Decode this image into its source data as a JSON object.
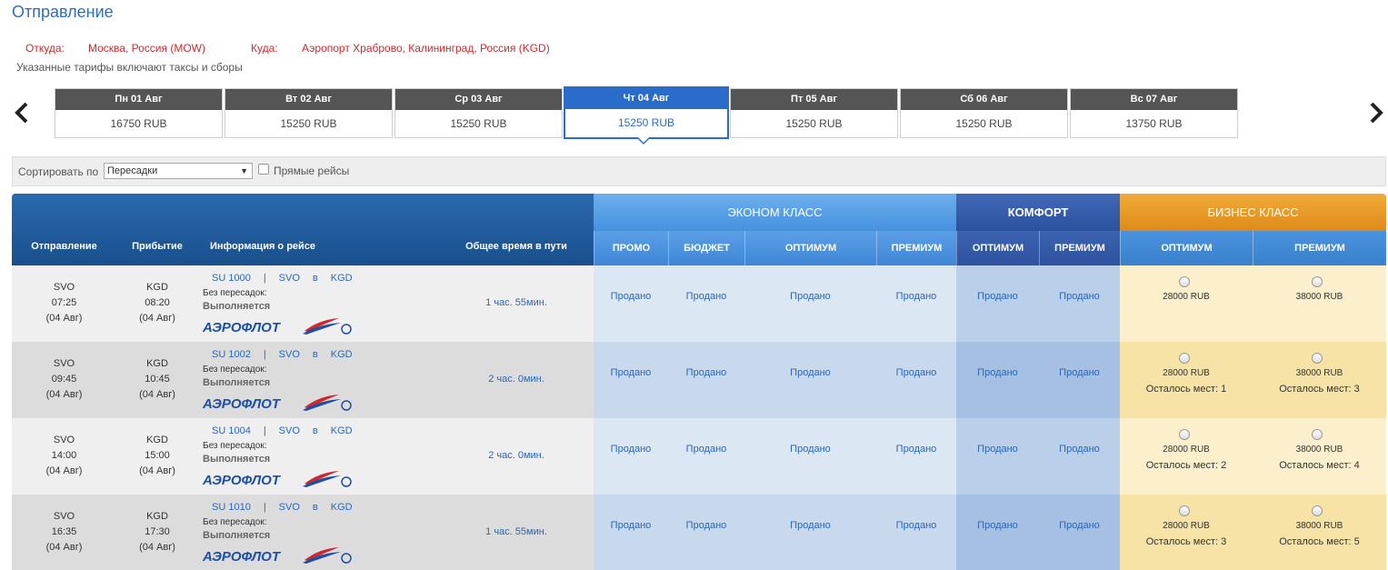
{
  "page": {
    "title": "Отправление"
  },
  "route": {
    "from_label": "Откуда:",
    "from_value": "Москва, Россия (MOW)",
    "to_label": "Куда:",
    "to_value": "Аэропорт Храброво, Калининград, Россия (KGD)",
    "note": "Указанные тарифы включают таксы и сборы"
  },
  "nav": {
    "prev_icon": "chevron-left-icon",
    "next_icon": "chevron-right-icon"
  },
  "days": [
    {
      "label": "Пн 01 Авг",
      "price": "16750 RUB"
    },
    {
      "label": "Вт 02 Авг",
      "price": "15250 RUB"
    },
    {
      "label": "Ср 03 Авг",
      "price": "15250 RUB"
    },
    {
      "label": "Чт 04 Авг",
      "price": "15250 RUB",
      "selected": true
    },
    {
      "label": "Пт 05 Авг",
      "price": "15250 RUB"
    },
    {
      "label": "Сб 06 Авг",
      "price": "15250 RUB"
    },
    {
      "label": "Вс 07 Авг",
      "price": "13750 RUB"
    }
  ],
  "sort": {
    "label": "Сортировать по",
    "selected": "Пересадки",
    "direct_label": "Прямые рейсы",
    "direct_checked": false
  },
  "table": {
    "headers": {
      "departure": "Отправление",
      "arrival": "Прибытие",
      "flight_info": "Информация о рейсе",
      "total_time": "Общее время в пути"
    },
    "classes": {
      "economy": "ЭКОНОМ КЛАСС",
      "comfort": "КОМФОРТ",
      "business": "БИЗНЕС КЛАСС"
    },
    "fare_columns": {
      "econ_promo": "ПРОМО",
      "econ_budget": "БЮДЖЕТ",
      "econ_optimum": "ОПТИМУМ",
      "econ_premium": "ПРЕМИУМ",
      "comf_optimum": "ОПТИМУМ",
      "comf_premium": "ПРЕМИУМ",
      "bus_optimum": "ОПТИМУМ",
      "bus_premium": "ПРЕМИУМ"
    },
    "sold_text": "Продано",
    "nonstop_text": "Без пересадок:",
    "status_text": "Выполняется",
    "in_text": "в",
    "airline_logo_text": "АЭРОФЛОТ",
    "rows": [
      {
        "dep_code": "SVO",
        "dep_time": "07:25",
        "dep_date": "(04 Авг)",
        "arr_code": "KGD",
        "arr_time": "08:20",
        "arr_date": "(04 Авг)",
        "flight": "SU 1000",
        "from": "SVO",
        "to": "KGD",
        "duration": "1 час. 55мин.",
        "bus_opt_price": "28000 RUB",
        "bus_opt_seats": "",
        "bus_prem_price": "38000 RUB",
        "bus_prem_seats": ""
      },
      {
        "dep_code": "SVO",
        "dep_time": "09:45",
        "dep_date": "(04 Авг)",
        "arr_code": "KGD",
        "arr_time": "10:45",
        "arr_date": "(04 Авг)",
        "flight": "SU 1002",
        "from": "SVO",
        "to": "KGD",
        "duration": "2 час. 0мин.",
        "bus_opt_price": "28000 RUB",
        "bus_opt_seats": "Осталось мест: 1",
        "bus_prem_price": "38000 RUB",
        "bus_prem_seats": "Осталось мест: 3"
      },
      {
        "dep_code": "SVO",
        "dep_time": "14:00",
        "dep_date": "(04 Авг)",
        "arr_code": "KGD",
        "arr_time": "15:00",
        "arr_date": "(04 Авг)",
        "flight": "SU 1004",
        "from": "SVO",
        "to": "KGD",
        "duration": "2 час. 0мин.",
        "bus_opt_price": "28000 RUB",
        "bus_opt_seats": "Осталось мест: 2",
        "bus_prem_price": "38000 RUB",
        "bus_prem_seats": "Осталось мест: 4"
      },
      {
        "dep_code": "SVO",
        "dep_time": "16:35",
        "dep_date": "(04 Авг)",
        "arr_code": "KGD",
        "arr_time": "17:30",
        "arr_date": "(04 Авг)",
        "flight": "SU 1010",
        "from": "SVO",
        "to": "KGD",
        "duration": "1 час. 55мин.",
        "bus_opt_price": "28000 RUB",
        "bus_opt_seats": "Осталось мест: 3",
        "bus_prem_price": "38000 RUB",
        "bus_prem_seats": "Осталось мест: 5"
      }
    ]
  },
  "colors": {
    "title_blue": "#2f6fb6",
    "route_red": "#d0282d",
    "selected_day": "#2a6cc9",
    "economy_header": "#4690df",
    "comfort_header": "#2b519e",
    "business_header": "#de8a1a",
    "link_blue": "#2b66b5"
  }
}
